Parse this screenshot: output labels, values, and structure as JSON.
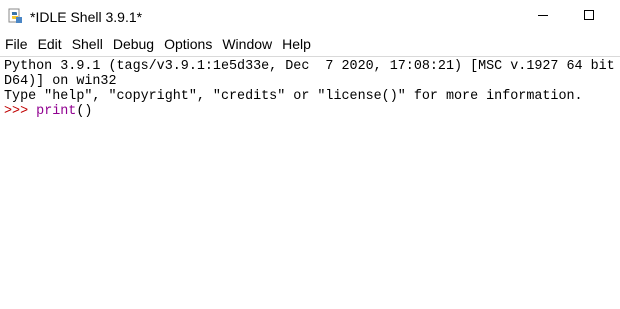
{
  "window": {
    "title": "*IDLE Shell 3.9.1*"
  },
  "icons": {
    "app": "python-idle-icon",
    "minimize": "minimize-icon",
    "maximize": "maximize-icon"
  },
  "menu": {
    "items": [
      "File",
      "Edit",
      "Shell",
      "Debug",
      "Options",
      "Window",
      "Help"
    ]
  },
  "shell": {
    "lines": [
      "Python 3.9.1 (tags/v3.9.1:1e5d33e, Dec  7 2020, 17:08:21) [MSC v.1927 64 bit",
      "D64)] on win32",
      "Type \"help\", \"copyright\", \"credits\" or \"license()\" for more information."
    ],
    "prompt": ">>> ",
    "input_builtin": "print",
    "input_rest": "()"
  },
  "colors": {
    "prompt": "#c00000",
    "builtin": "#900090",
    "background": "#ffffff"
  }
}
